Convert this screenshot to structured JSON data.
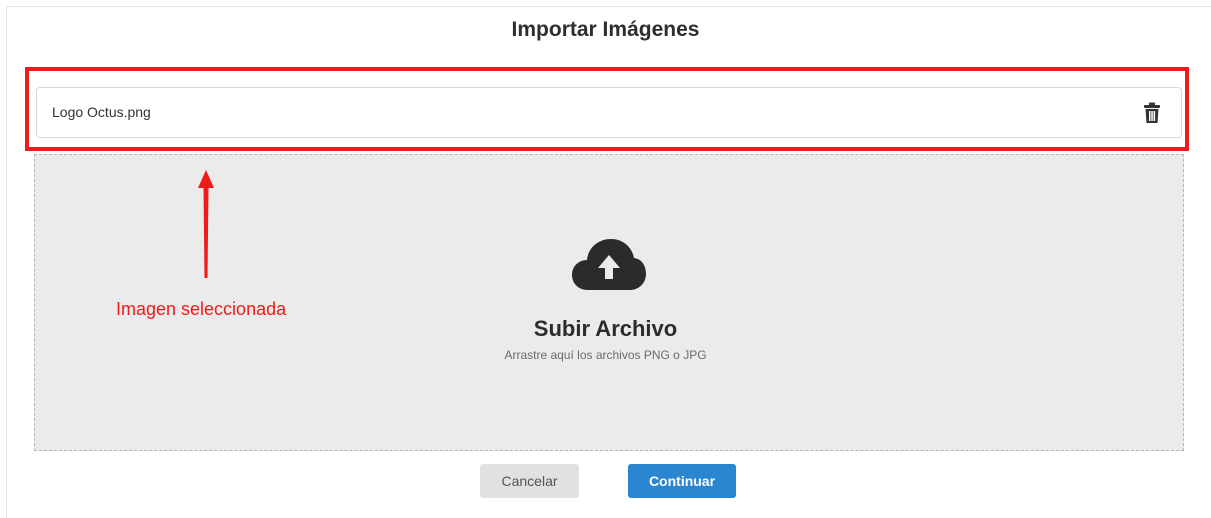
{
  "dialog": {
    "title": "Importar Imágenes"
  },
  "file": {
    "name": "Logo Octus.png",
    "delete_icon": "trash-icon"
  },
  "dropzone": {
    "icon": "cloud-upload-icon",
    "title": "Subir Archivo",
    "subtitle": "Arrastre aquí los archivos PNG o JPG"
  },
  "annotation": {
    "label": "Imagen seleccionada",
    "color": "#ef1b1b"
  },
  "buttons": {
    "cancel_label": "Cancelar",
    "continue_label": "Continuar"
  },
  "colors": {
    "primary": "#2a86d1",
    "cancel_bg": "#dfe1e2",
    "dropzone_bg": "#ebebeb"
  }
}
